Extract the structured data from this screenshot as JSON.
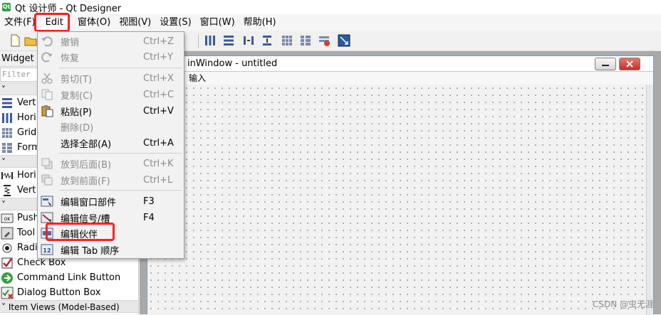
{
  "window": {
    "title": "Qt 设计师 - Qt Designer",
    "app_icon": "Qt"
  },
  "menubar": [
    {
      "label": "文件(F)"
    },
    {
      "label": "Edit"
    },
    {
      "label": "窗体(O)"
    },
    {
      "label": "视图(V)"
    },
    {
      "label": "设置(S)"
    },
    {
      "label": "窗口(W)"
    },
    {
      "label": "帮助(H)"
    }
  ],
  "edit_menu": [
    {
      "label": "撤销",
      "shortcut": "Ctrl+Z",
      "icon": "undo-icon",
      "disabled": true
    },
    {
      "label": "恢复",
      "shortcut": "Ctrl+Y",
      "icon": "redo-icon",
      "disabled": true
    },
    {
      "label": "剪切(T)",
      "shortcut": "Ctrl+X",
      "icon": "cut-icon",
      "disabled": true
    },
    {
      "label": "复制(C)",
      "shortcut": "Ctrl+C",
      "icon": "copy-icon",
      "disabled": true
    },
    {
      "label": "粘贴(P)",
      "shortcut": "Ctrl+V",
      "icon": "paste-icon",
      "disabled": false
    },
    {
      "label": "删除(D)",
      "shortcut": "",
      "icon": "",
      "disabled": true
    },
    {
      "label": "选择全部(A)",
      "shortcut": "Ctrl+A",
      "icon": "",
      "disabled": false
    },
    {
      "label": "放到后面(B)",
      "shortcut": "Ctrl+K",
      "icon": "send-back-icon",
      "disabled": true
    },
    {
      "label": "放到前面(F)",
      "shortcut": "Ctrl+L",
      "icon": "bring-front-icon",
      "disabled": true
    },
    {
      "label": "编辑窗口部件",
      "shortcut": "F3",
      "icon": "edit-widgets-icon",
      "disabled": false
    },
    {
      "label": "编辑信号/槽",
      "shortcut": "F4",
      "icon": "edit-signals-icon",
      "disabled": false
    },
    {
      "label": "编辑伙伴",
      "shortcut": "",
      "icon": "edit-buddies-icon",
      "disabled": false
    },
    {
      "label": "编辑 Tab 顺序",
      "shortcut": "",
      "icon": "tab-order-icon",
      "disabled": false
    }
  ],
  "widget_box": {
    "header": "Widget",
    "filter_placeholder": "Filter",
    "items_layouts": [
      "Vert",
      "Hori",
      "Grid",
      "Form"
    ],
    "items_spacers": [
      "Hori",
      "Vert"
    ],
    "items_buttons": [
      "Push",
      "Tool",
      "Radi",
      "Check Box",
      "Command Link Button",
      "Dialog Button Box"
    ],
    "category_item_views": "Item Views (Model-Based)"
  },
  "form": {
    "title": "inWindow - untitled",
    "menu_placeholder": "输入"
  },
  "watermark": "CSDN @虫无涯",
  "colors": {
    "highlight": "#ff1f1f",
    "accent": "#2f9e3f"
  }
}
